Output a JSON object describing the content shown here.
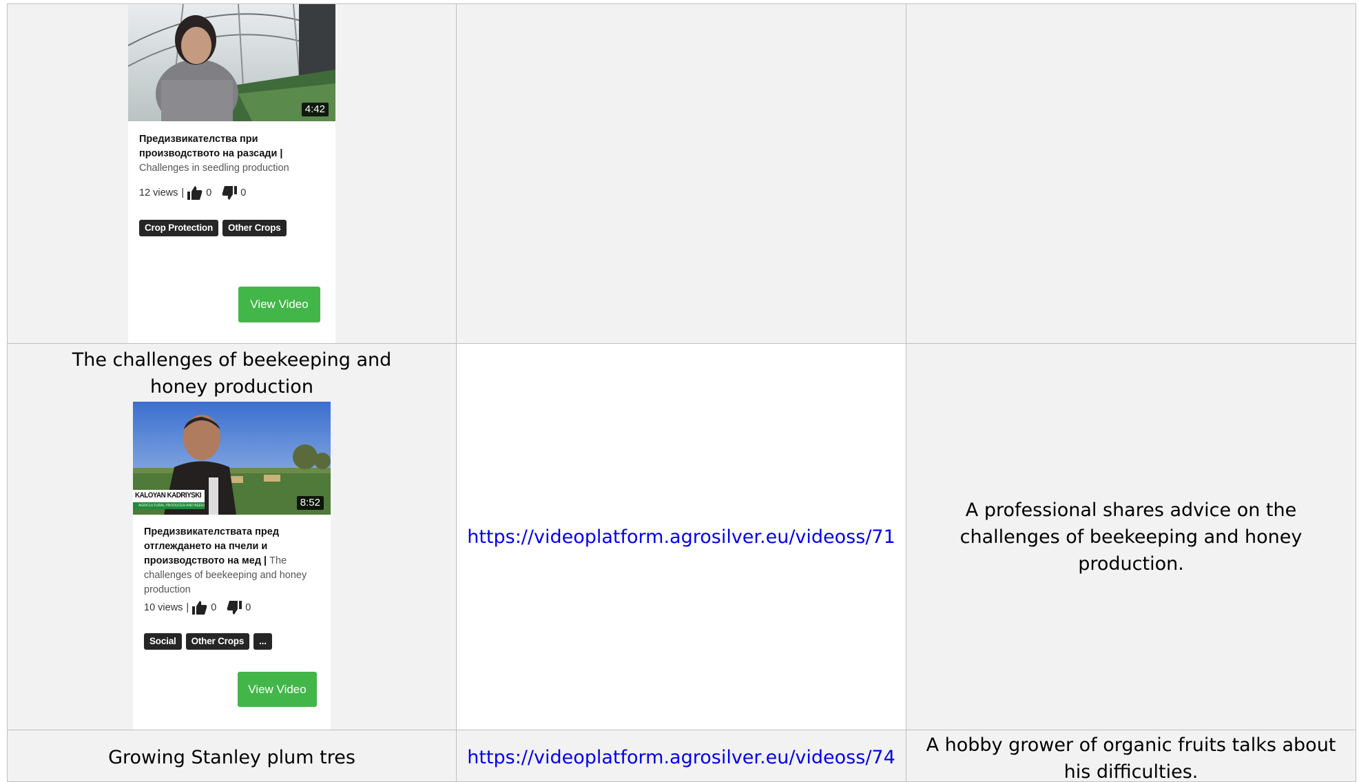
{
  "rows": [
    {
      "video": {
        "duration": "4:42",
        "title_bg": "Предизвикателства при производството на разсади",
        "title_sep": " | ",
        "title_en": "Challenges in seedling production",
        "views": "12 views",
        "likes": "0",
        "dislikes": "0",
        "tags": [
          "Crop Protection",
          "Other Crops"
        ],
        "button_label": "View Video"
      }
    },
    {
      "title": "The challenges of beekeeping and honey production",
      "url": "https://videoplatform.agrosilver.eu/videoss/71",
      "description": "A professional shares advice on the challenges of beekeeping and honey production.",
      "video": {
        "duration": "8:52",
        "overlay_name": "KALOYAN KADRIYSKI",
        "overlay_subtitle": "AGRICULTURAL PRODUCER AND BEEKEEPER",
        "title_bg": "Предизвикателствата пред отглеждането на пчели и производството на мед",
        "title_sep": " | ",
        "title_en": "The challenges of beekeeping and honey production",
        "views": "10 views",
        "likes": "0",
        "dislikes": "0",
        "tags": [
          "Social",
          "Other Crops",
          "..."
        ],
        "button_label": "View Video"
      }
    },
    {
      "title": "Growing Stanley plum tres",
      "url": "https://videoplatform.agrosilver.eu/videoss/74",
      "description": "A hobby grower of organic fruits talks about his difficulties."
    }
  ],
  "colors": {
    "cell_shade": "#f2f2f2",
    "link": "#0000ee",
    "button": "#43b649",
    "tag": "#262626"
  }
}
